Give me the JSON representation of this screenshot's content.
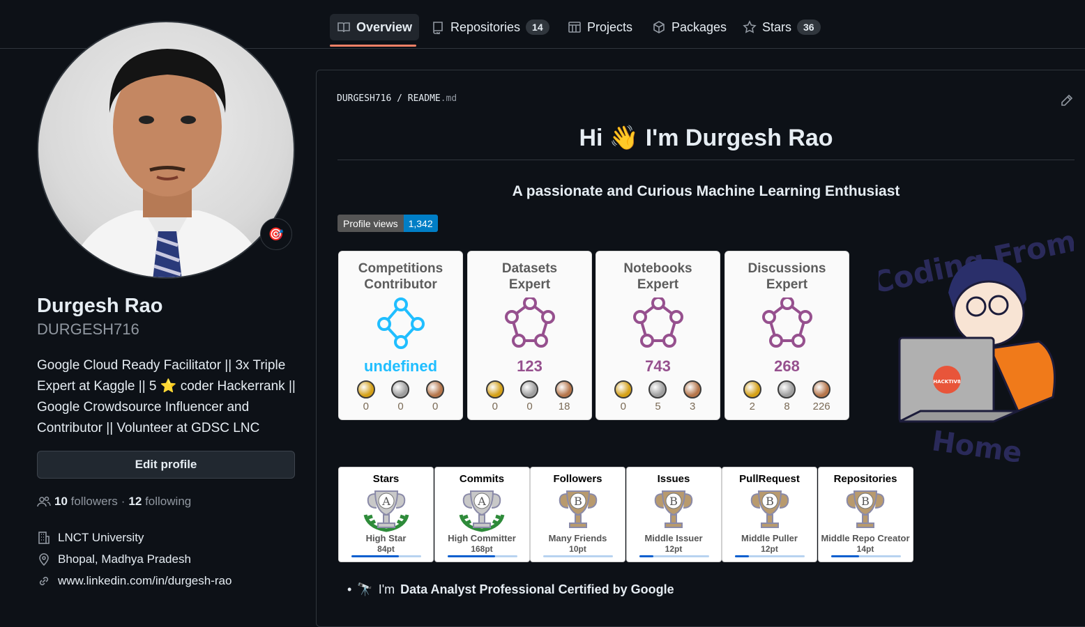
{
  "nav": {
    "tabs": [
      {
        "label": "Overview",
        "count": ""
      },
      {
        "label": "Repositories",
        "count": "14"
      },
      {
        "label": "Projects",
        "count": ""
      },
      {
        "label": "Packages",
        "count": ""
      },
      {
        "label": "Stars",
        "count": "36"
      }
    ]
  },
  "profile": {
    "status_emoji": "🎯",
    "name": "Durgesh Rao",
    "login": "DURGESH716",
    "bio_parts": [
      "Google Cloud Ready Facilitator || 3x Triple Expert at Kaggle || 5 ",
      "⭐",
      " coder Hackerrank || Google Crowdsource Influencer and Contributor || Volunteer at GDSC LNC"
    ],
    "edit_label": "Edit profile",
    "followers_count": "10",
    "followers_label": "followers",
    "separator": "·",
    "following_count": "12",
    "following_label": "following",
    "organization": "LNCT University",
    "location": "Bhopal, Madhya Pradesh",
    "link": "www.linkedin.com/in/durgesh-rao"
  },
  "readme": {
    "owner": "DURGESH716",
    "path_sep": "/",
    "file_base": "README",
    "file_ext": ".md",
    "greeting_pre": "Hi",
    "greeting_emoji": "👋",
    "greeting_post": "I'm Durgesh Rao",
    "subtitle": "A passionate and Curious Machine Learning Enthusiast",
    "views_label": "Profile views",
    "views_count": "1,342",
    "kaggle_cards": [
      {
        "line1": "Competitions",
        "line2": "Contributor",
        "value": "undefined",
        "gold": "0",
        "silver": "0",
        "bronze": "0",
        "color": "#20beff"
      },
      {
        "line1": "Datasets",
        "line2": "Expert",
        "value": "123",
        "gold": "0",
        "silver": "0",
        "bronze": "18",
        "color": "#96508e"
      },
      {
        "line1": "Notebooks",
        "line2": "Expert",
        "value": "743",
        "gold": "0",
        "silver": "5",
        "bronze": "3",
        "color": "#96508e"
      },
      {
        "line1": "Discussions",
        "line2": "Expert",
        "value": "268",
        "gold": "2",
        "silver": "8",
        "bronze": "226",
        "color": "#96508e"
      }
    ],
    "trophies": [
      {
        "title": "Stars",
        "grade": "A",
        "rank": "High Star",
        "points": "84pt",
        "progress": 0.68
      },
      {
        "title": "Commits",
        "grade": "A",
        "rank": "High Committer",
        "points": "168pt",
        "progress": 0.68
      },
      {
        "title": "Followers",
        "grade": "B",
        "rank": "Many Friends",
        "points": "10pt",
        "progress": 0.0
      },
      {
        "title": "Issues",
        "grade": "B",
        "rank": "Middle Issuer",
        "points": "12pt",
        "progress": 0.2
      },
      {
        "title": "PullRequest",
        "grade": "B",
        "rank": "Middle Puller",
        "points": "12pt",
        "progress": 0.2
      },
      {
        "title": "Repositories",
        "grade": "B",
        "rank": "Middle Repo Creator",
        "points": "14pt",
        "progress": 0.4
      }
    ],
    "bullet_emoji": "🔭",
    "bullet_pre": "I'm",
    "bullet_bold": "Data Analyst Professional Certified by Google",
    "illustration_badge": "HACKTIV8",
    "illustration_caption_top": "Coding From",
    "illustration_caption_bottom": "Home"
  },
  "colors": {
    "accent": "#f78166",
    "gold": "#d4a017",
    "silver": "#9e9e9e",
    "bronze": "#b5754a"
  }
}
